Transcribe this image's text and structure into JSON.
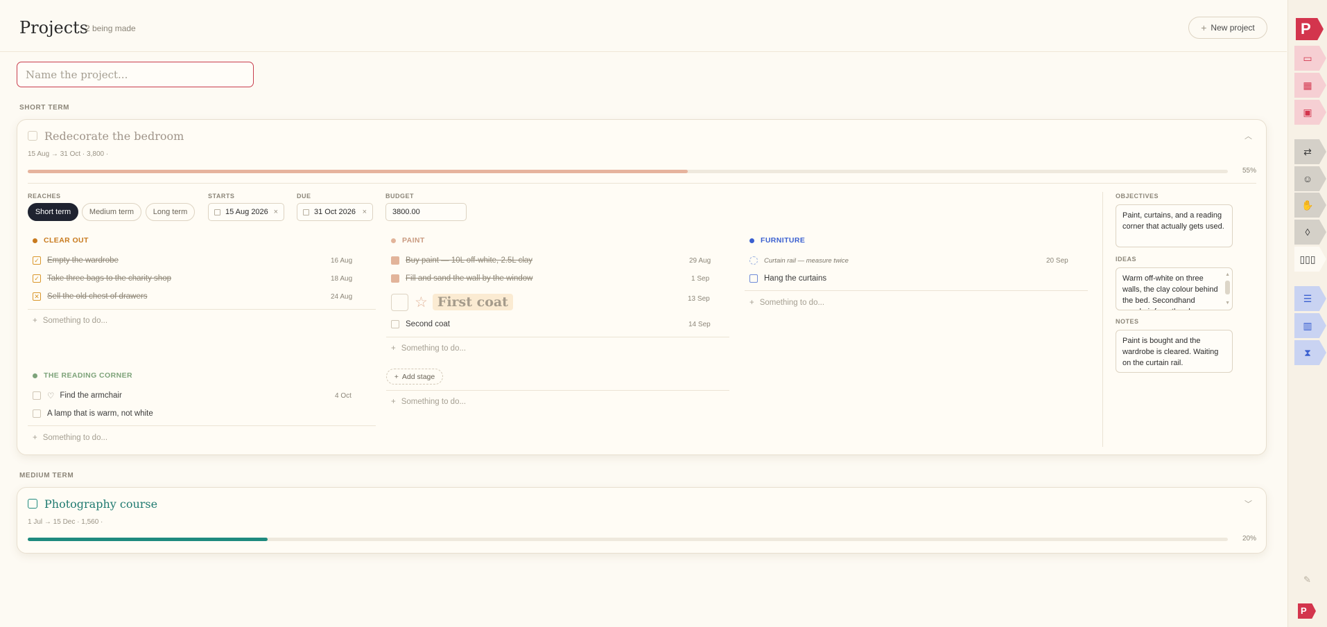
{
  "header": {
    "title": "Projects",
    "subtitle": "2 being made",
    "new_project_label": "New project"
  },
  "name_input": {
    "placeholder": "Name the project..."
  },
  "sections": {
    "short_term": "SHORT TERM",
    "medium_term": "MEDIUM TERM"
  },
  "project1": {
    "title": "Redecorate the bedroom",
    "meta": "15 Aug → 31 Oct · 3,800 ·",
    "progress_pct": "55%",
    "progress_value": 0.55,
    "accent": "#e8b8a0",
    "labels": {
      "reaches": "REACHES",
      "starts": "STARTS",
      "due": "DUE",
      "budget": "BUDGET",
      "objectives": "OBJECTIVES",
      "ideas": "IDEAS",
      "notes": "NOTES"
    },
    "reach_options": [
      "Short term",
      "Medium term",
      "Long term"
    ],
    "starts": "15 Aug 2026",
    "due": "31 Oct 2026",
    "budget": "3800.00",
    "objectives": "Paint, curtains, and a reading corner that actually gets used.",
    "ideas": "Warm off-white on three walls, the clay colour behind the bed. Secondhand armchair from the place on Aurora",
    "notes": "Paint is bought and the wardrobe is cleared. Waiting on the curtain rail.",
    "add_placeholder": "Something to do...",
    "add_stage_label": "Add stage",
    "groups": {
      "clear_out": {
        "name": "CLEAR OUT",
        "color": "#c87a1e",
        "tasks": [
          {
            "text": "Empty the wardrobe",
            "date": "16 Aug"
          },
          {
            "text": "Take three bags to the charity shop",
            "date": "18 Aug"
          },
          {
            "text": "Sell the old chest of drawers",
            "date": "24 Aug"
          }
        ]
      },
      "reading": {
        "name": "THE READING CORNER",
        "color": "#7da37a",
        "tasks": [
          {
            "text": "Find the armchair",
            "date": "4 Oct"
          },
          {
            "text": "A lamp that is warm, not white",
            "date": ""
          }
        ]
      },
      "paint": {
        "name": "PAINT",
        "color": "#e2b49a",
        "tasks": [
          {
            "text": "Buy paint — 10L off-white, 2.5L clay",
            "date": "29 Aug"
          },
          {
            "text": "Fill and sand the wall by the window",
            "date": "1 Sep"
          },
          {
            "text": "First coat",
            "date": "13 Sep"
          },
          {
            "text": "Second coat",
            "date": "14 Sep"
          }
        ]
      },
      "furniture": {
        "name": "FURNITURE",
        "color": "#3a5fd0",
        "tasks": [
          {
            "text": "Curtain rail — measure twice",
            "date": "20 Sep"
          },
          {
            "text": "Hang the curtains",
            "date": ""
          }
        ]
      }
    }
  },
  "project2": {
    "title": "Photography course",
    "meta": "1 Jul → 15 Dec · 1,560 ·",
    "progress_pct": "20%",
    "progress_value": 0.2,
    "accent": "#1f8a7e"
  },
  "rail": {
    "logo": "P",
    "icons": [
      "calendar-day-icon",
      "calendar-month-icon",
      "calendar-year-icon",
      "repeat-icon",
      "mood-icon",
      "hand-icon",
      "drop-icon",
      "projects-icon",
      "checklist-icon",
      "books-icon",
      "hourglass-icon",
      "pencil-icon",
      "logo-small-icon"
    ]
  }
}
